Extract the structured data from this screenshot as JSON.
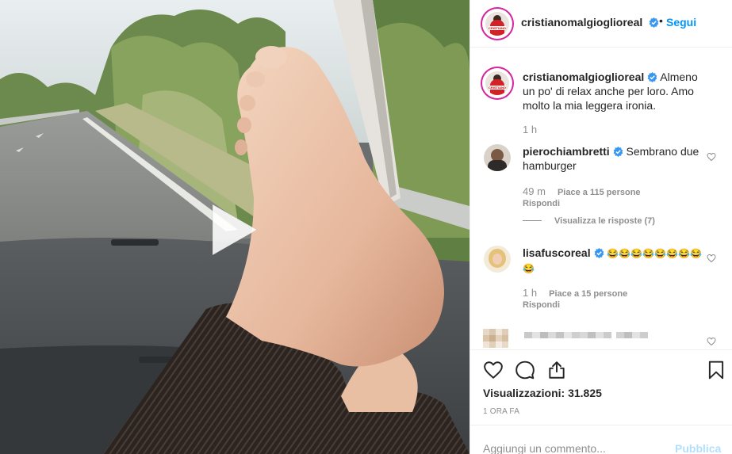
{
  "post": {
    "author": "cristianomalgioglioreal",
    "header_dot": "•",
    "follow_label": "Segui"
  },
  "caption": {
    "username": "cristianomalgioglioreal",
    "text": "Almeno un po' di relax anche per loro. Amo molto la mia leggera ironia.",
    "time": "1 h"
  },
  "comments": [
    {
      "username": "pierochiambretti",
      "text": "Sembrano due hamburger",
      "time": "49 m",
      "likes": "Piace a 115 persone",
      "reply_label": "Rispondi",
      "view_replies": "Visualizza le risposte (7)"
    },
    {
      "username": "lisafuscoreal",
      "text": "😂😂😂😂😂😂😂😂😂",
      "time": "1 h",
      "likes": "Piace a 15 persone",
      "reply_label": "Rispondi"
    }
  ],
  "stats": {
    "views": "Visualizzazioni: 31.825",
    "posted_ago": "1 ORA FA"
  },
  "add_comment": {
    "placeholder": "Aggiungi un commento...",
    "publish_label": "Pubblica"
  },
  "icons": {
    "like": "heart-icon",
    "comment": "comment-icon",
    "share": "share-icon",
    "save": "bookmark-icon",
    "play": "play-icon",
    "verified": "verified-badge-icon"
  },
  "colors": {
    "link_blue": "#0095f6",
    "publish_disabled": "#b2dffc",
    "verified_blue": "#3897f0",
    "muted": "#8e8e8e"
  }
}
